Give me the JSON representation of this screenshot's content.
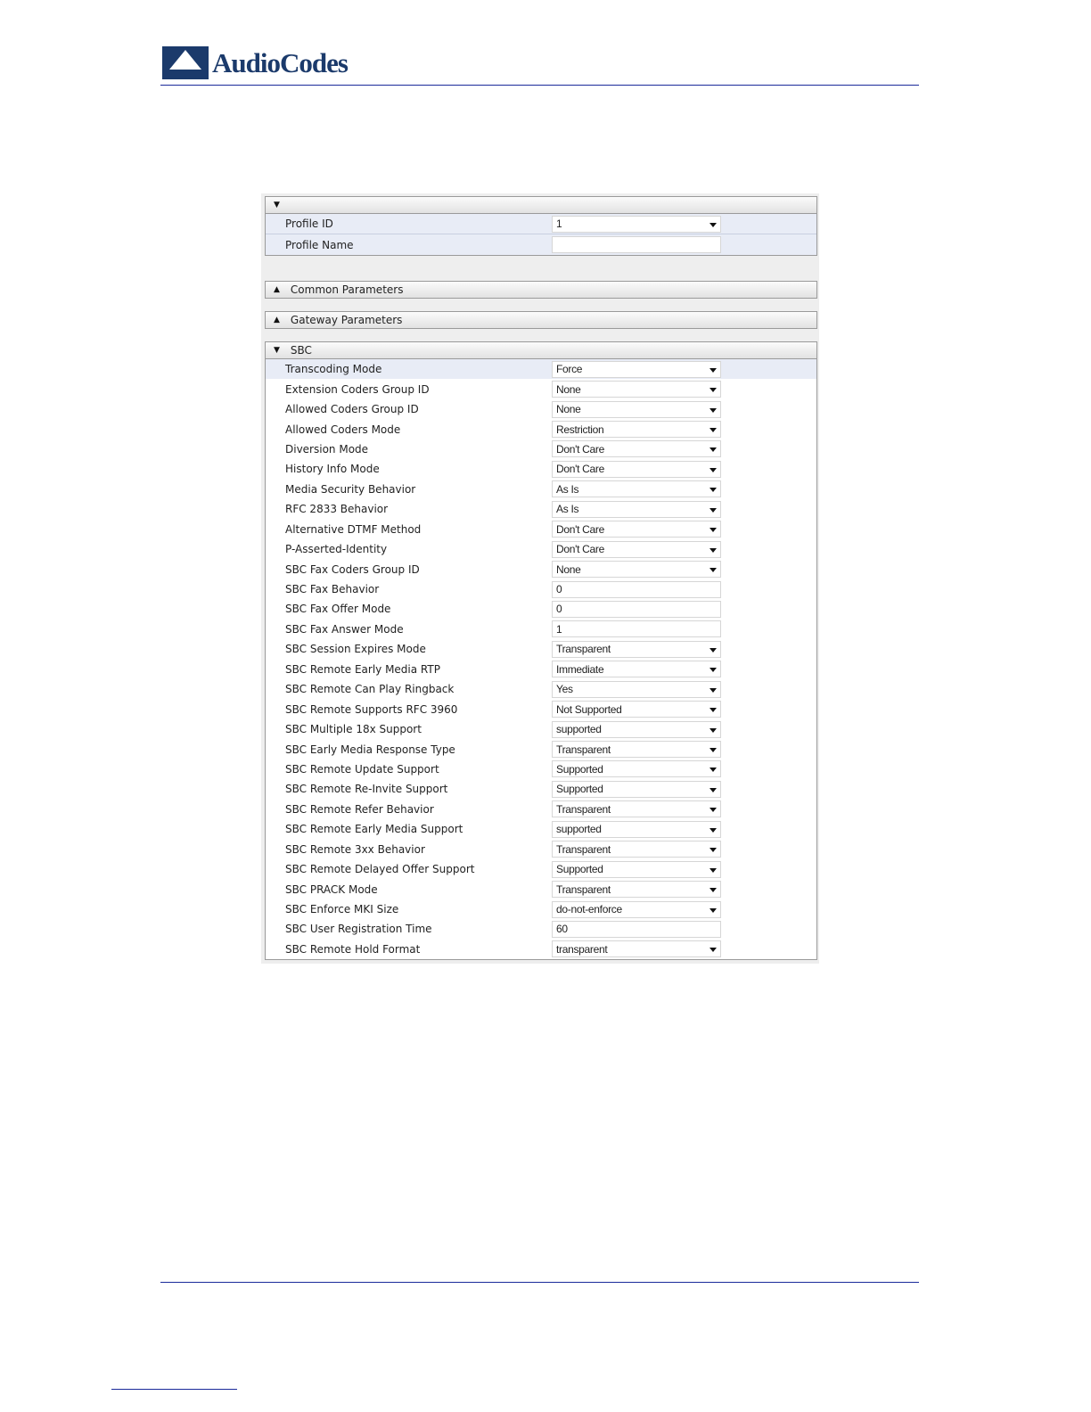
{
  "logo": {
    "text": "AudioCodes"
  },
  "profile": {
    "rows": [
      {
        "label": "Profile ID",
        "value": "1",
        "type": "select"
      },
      {
        "label": "Profile Name",
        "value": "",
        "type": "text"
      }
    ]
  },
  "sections": {
    "common": "Common Parameters",
    "gateway": "Gateway Parameters",
    "sbc": "SBC"
  },
  "sbc_rows": [
    {
      "label": "Transcoding Mode",
      "value": "Force",
      "type": "select"
    },
    {
      "label": "Extension Coders Group ID",
      "value": "None",
      "type": "select"
    },
    {
      "label": "Allowed Coders Group ID",
      "value": "None",
      "type": "select"
    },
    {
      "label": "Allowed Coders Mode",
      "value": "Restriction",
      "type": "select"
    },
    {
      "label": "Diversion Mode",
      "value": "Don't Care",
      "type": "select"
    },
    {
      "label": "History Info Mode",
      "value": "Don't Care",
      "type": "select"
    },
    {
      "label": "Media Security Behavior",
      "value": "As Is",
      "type": "select"
    },
    {
      "label": "RFC 2833 Behavior",
      "value": "As Is",
      "type": "select"
    },
    {
      "label": "Alternative DTMF Method",
      "value": "Don't Care",
      "type": "select"
    },
    {
      "label": "P-Asserted-Identity",
      "value": "Don't Care",
      "type": "select"
    },
    {
      "label": "SBC Fax Coders Group ID",
      "value": "None",
      "type": "select"
    },
    {
      "label": "SBC Fax Behavior",
      "value": "0",
      "type": "text"
    },
    {
      "label": "SBC Fax Offer Mode",
      "value": "0",
      "type": "text"
    },
    {
      "label": "SBC Fax Answer Mode",
      "value": "1",
      "type": "text"
    },
    {
      "label": "SBC Session Expires Mode",
      "value": "Transparent",
      "type": "select"
    },
    {
      "label": "SBC Remote Early Media RTP",
      "value": "Immediate",
      "type": "select"
    },
    {
      "label": "SBC Remote Can Play Ringback",
      "value": "Yes",
      "type": "select"
    },
    {
      "label": "SBC Remote Supports RFC 3960",
      "value": "Not Supported",
      "type": "select"
    },
    {
      "label": "SBC Multiple 18x Support",
      "value": "supported",
      "type": "select"
    },
    {
      "label": "SBC Early Media Response Type",
      "value": "Transparent",
      "type": "select"
    },
    {
      "label": "SBC Remote Update Support",
      "value": "Supported",
      "type": "select"
    },
    {
      "label": "SBC Remote Re-Invite Support",
      "value": "Supported",
      "type": "select"
    },
    {
      "label": "SBC Remote Refer Behavior",
      "value": "Transparent",
      "type": "select"
    },
    {
      "label": "SBC Remote Early Media Support",
      "value": "supported",
      "type": "select"
    },
    {
      "label": "SBC Remote 3xx Behavior",
      "value": "Transparent",
      "type": "select"
    },
    {
      "label": "SBC Remote Delayed Offer Support",
      "value": "Supported",
      "type": "select"
    },
    {
      "label": "SBC PRACK Mode",
      "value": "Transparent",
      "type": "select"
    },
    {
      "label": "SBC Enforce MKI Size",
      "value": "do-not-enforce",
      "type": "select"
    },
    {
      "label": "SBC User Registration Time",
      "value": "60",
      "type": "text"
    },
    {
      "label": "SBC Remote Hold Format",
      "value": "transparent",
      "type": "select"
    }
  ]
}
